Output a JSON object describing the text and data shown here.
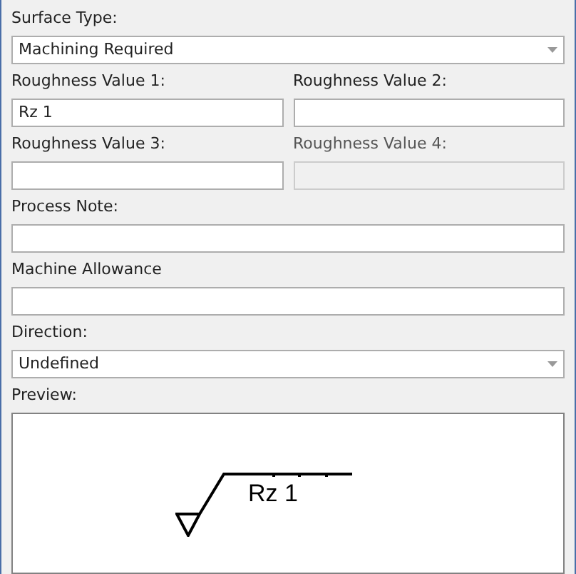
{
  "surface_type": {
    "label": "Surface Type:",
    "value": "Machining Required"
  },
  "roughness": [
    {
      "label": "Roughness Value 1:",
      "value": "Rz 1",
      "disabled": false
    },
    {
      "label": "Roughness Value 2:",
      "disabled": false
    },
    {
      "label": "Roughness Value 3:",
      "disabled": false
    },
    {
      "label": "Roughness Value 4:",
      "disabled": true
    }
  ],
  "process_note": {
    "label": "Process Note:"
  },
  "machine_allowance": {
    "label": "Machine Allowance"
  },
  "direction": {
    "label": "Direction:",
    "value": "Undefined"
  },
  "preview": {
    "label": "Preview:",
    "text": "Rz 1"
  }
}
